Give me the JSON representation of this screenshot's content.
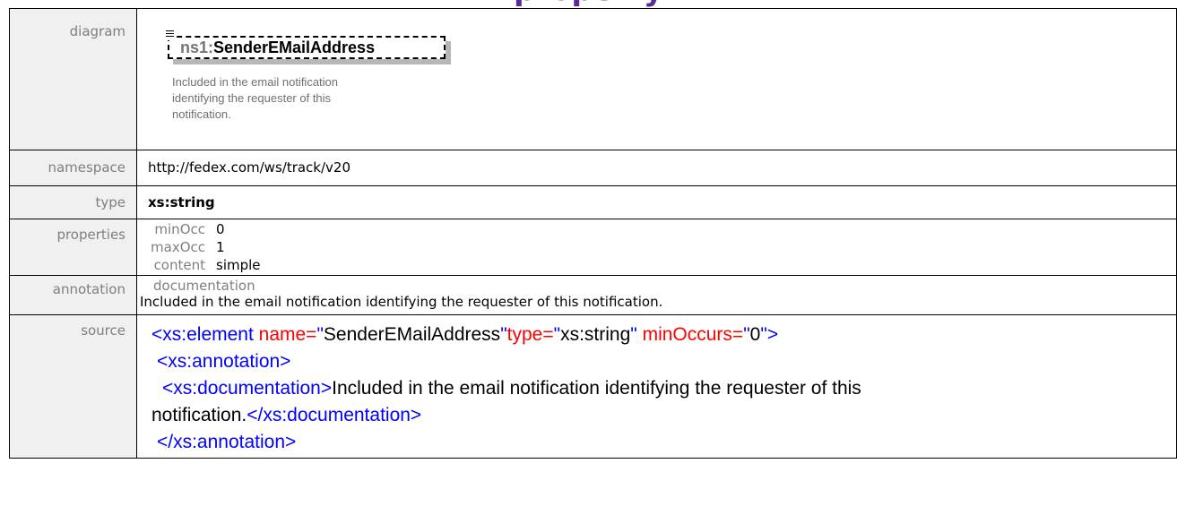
{
  "header": {
    "title_fragment": "property"
  },
  "rows": {
    "diagram": {
      "label": "diagram",
      "element_prefix": "ns1:",
      "element_name": "SenderEMailAddress",
      "annotation_lines": [
        "Included in the email notification",
        "identifying the requester of this",
        "notification."
      ]
    },
    "namespace": {
      "label": "namespace",
      "value": "http://fedex.com/ws/track/v20"
    },
    "type": {
      "label": "type",
      "value": "xs:string"
    },
    "properties": {
      "label": "properties",
      "items": [
        {
          "key": "minOcc",
          "value": "0"
        },
        {
          "key": "maxOcc",
          "value": "1"
        },
        {
          "key": "content",
          "value": "simple"
        }
      ]
    },
    "annotation": {
      "label": "annotation",
      "title": "documentation",
      "text": "Included in the email notification identifying the requester of this notification."
    },
    "source": {
      "label": "source",
      "line1": {
        "open": "<xs:element",
        "attr1": " name=",
        "q1": "\"",
        "val1": "SenderEMailAddress",
        "q2": "\"",
        "attr2": "type=",
        "q3": "\"",
        "val2": "xs:string",
        "q4": "\"",
        "attr3": " minOccurs=",
        "q5": "\"",
        "val3": "0",
        "close": "\">"
      },
      "line2": "<xs:annotation>",
      "line3_open": "<xs:documentation>",
      "line3_text": "Included in the email notification identifying the requester of this",
      "line4_text": "notification.",
      "line4_close": "</xs:documentation>",
      "line5": "</xs:annotation>"
    }
  },
  "colors": {
    "title": "#5a2a9a",
    "label_bg": "#f0f0f0",
    "label_text": "#7f7f7f",
    "xml_tag": "#0000ff",
    "xml_element": "#8b0000",
    "xml_attr": "#ff0000"
  }
}
